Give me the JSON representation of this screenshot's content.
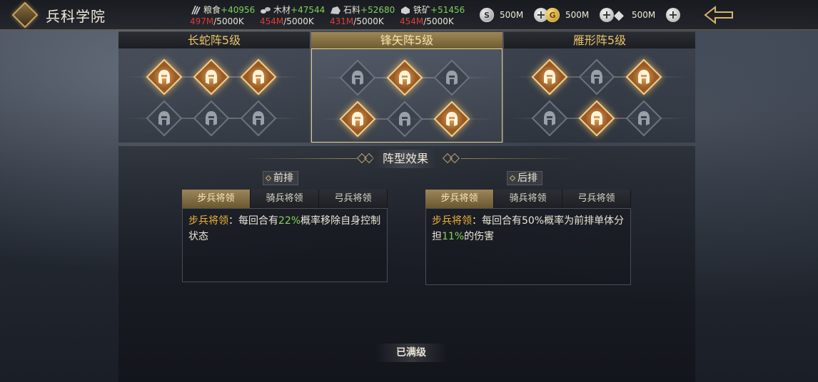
{
  "header": {
    "title": "兵科学院",
    "resources": [
      {
        "icon": "grain-icon",
        "name": "粮食",
        "gain": "+40956",
        "current": "497M",
        "max": "/5000K"
      },
      {
        "icon": "wood-icon",
        "name": "木材",
        "gain": "+47544",
        "current": "454M",
        "max": "/5000K"
      },
      {
        "icon": "stone-icon",
        "name": "石料",
        "gain": "+52680",
        "current": "431M",
        "max": "/5000K"
      },
      {
        "icon": "iron-icon",
        "name": "铁矿",
        "gain": "+51456",
        "current": "454M",
        "max": "/5000K"
      }
    ],
    "currencies": [
      {
        "icon": "silver-coin-icon",
        "glyph": "S",
        "amount": "500M"
      },
      {
        "icon": "gold-coin-icon",
        "glyph": "G",
        "amount": "500M"
      },
      {
        "icon": "diamond-icon",
        "glyph": "◆",
        "amount": "500M"
      }
    ],
    "plus": "+"
  },
  "formations": [
    {
      "name": "长蛇阵5级",
      "selected": false,
      "top_row": [
        true,
        true,
        true
      ],
      "bottom_row": [
        false,
        false,
        false
      ]
    },
    {
      "name": "锋矢阵5级",
      "selected": true,
      "top_row": [
        false,
        true,
        false
      ],
      "bottom_row": [
        true,
        false,
        true
      ]
    },
    {
      "name": "雁形阵5级",
      "selected": false,
      "top_row": [
        true,
        false,
        true
      ],
      "bottom_row": [
        false,
        true,
        false
      ]
    }
  ],
  "effect": {
    "title": "阵型效果",
    "front": {
      "label": "前排",
      "tabs": [
        "步兵将领",
        "骑兵将领",
        "弓兵将领"
      ],
      "active_tab": 0,
      "desc": {
        "kw": "步兵将领",
        "p1": "：每回合有",
        "num": "22%",
        "p2": "概率移除自身控制状态"
      }
    },
    "back": {
      "label": "后排",
      "tabs": [
        "步兵将领",
        "骑兵将领",
        "弓兵将领"
      ],
      "active_tab": 0,
      "desc": {
        "kw": "步兵将领",
        "p1": "：每回合有50%概率为前排单体分担",
        "num": "11%",
        "p2": "的伤害"
      }
    }
  },
  "status": "已满级",
  "colors": {
    "accent_gold": "#e9c46a",
    "gain_green": "#7fd35a",
    "warn_red": "#e23b32",
    "keyword_orange": "#f0b437"
  }
}
